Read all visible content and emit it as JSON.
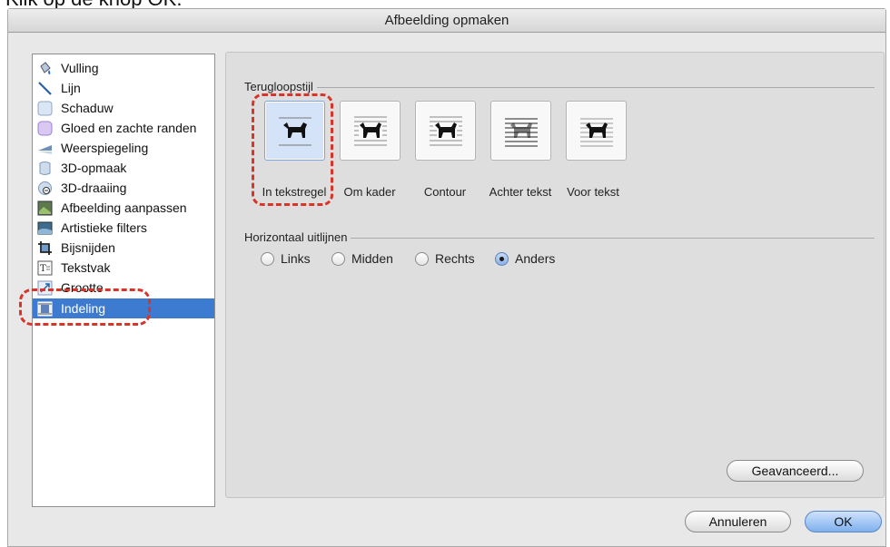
{
  "caption": "Klik op de knop OK.",
  "dialog": {
    "title": "Afbeelding opmaken"
  },
  "sidebar": {
    "items": [
      {
        "label": "Vulling",
        "icon": "paint-bucket-icon"
      },
      {
        "label": "Lijn",
        "icon": "line-icon"
      },
      {
        "label": "Schaduw",
        "icon": "shadow-icon"
      },
      {
        "label": "Gloed en zachte randen",
        "icon": "glow-icon"
      },
      {
        "label": "Weerspiegeling",
        "icon": "reflection-icon"
      },
      {
        "label": "3D-opmaak",
        "icon": "3d-format-icon"
      },
      {
        "label": "3D-draaiing",
        "icon": "3d-rotation-icon"
      },
      {
        "label": "Afbeelding aanpassen",
        "icon": "adjust-picture-icon"
      },
      {
        "label": "Artistieke filters",
        "icon": "artistic-filters-icon"
      },
      {
        "label": "Bijsnijden",
        "icon": "crop-icon"
      },
      {
        "label": "Tekstvak",
        "icon": "text-box-icon"
      },
      {
        "label": "Grootte",
        "icon": "size-icon"
      },
      {
        "label": "Indeling",
        "icon": "layout-icon",
        "selected": true
      }
    ]
  },
  "wrap": {
    "label": "Terugloopstijl",
    "options": [
      {
        "label": "In tekstregel",
        "selected": true
      },
      {
        "label": "Om kader",
        "selected": false
      },
      {
        "label": "Contour",
        "selected": false
      },
      {
        "label": "Achter tekst",
        "selected": false
      },
      {
        "label": "Voor tekst",
        "selected": false
      }
    ]
  },
  "align": {
    "label": "Horizontaal uitlijnen",
    "options": [
      {
        "label": "Links",
        "checked": false
      },
      {
        "label": "Midden",
        "checked": false
      },
      {
        "label": "Rechts",
        "checked": false
      },
      {
        "label": "Anders",
        "checked": true
      }
    ]
  },
  "buttons": {
    "advanced": "Geavanceerd...",
    "cancel": "Annuleren",
    "ok": "OK"
  },
  "colors": {
    "selection": "#3d7bd0",
    "highlight_dash": "#d7352a",
    "default_button": "#7fb0ee"
  }
}
